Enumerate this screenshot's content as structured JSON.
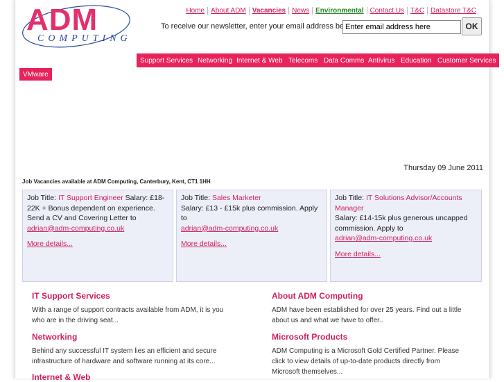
{
  "logo": {
    "top": "ADM",
    "bottom": "COMPUTING"
  },
  "toplinks": [
    "Home",
    "About ADM",
    "Vacancies",
    "News",
    "Environmental",
    "Contact Us",
    "T&C",
    "Datastore T&C"
  ],
  "newsletter": {
    "text": "To receive our newsletter, enter your email address below:",
    "placeholder": "Enter email address here",
    "ok": "OK"
  },
  "nav": [
    "Support Services",
    "Networking",
    "Internet & Web",
    "Telecoms",
    "Data Comms",
    "Antivirus",
    "Education",
    "Customer Services",
    "VMware"
  ],
  "date": "Thursday 09 June 2011",
  "vacancies": {
    "heading": "Job Vacancies available at ADM Computing, Canterbury, Kent, CT1 1HH",
    "jobs": [
      {
        "prefix": "Job Title:",
        "title": "IT Support Engineer",
        "desc": "Salary: £18-22K + Bonus dependent on experience. Send a CV and Covering Letter to",
        "email": "adrian@adm-computing.co.uk",
        "more": "More details..."
      },
      {
        "prefix": "Job Title:",
        "title": "Sales Marketer",
        "desc": "Salary: £13 - £15k plus commission. Apply to",
        "email": "adrian@adm-computing.co.uk",
        "more": "More details..."
      },
      {
        "prefix": "Job Title:",
        "title": "IT Solutions Advisor/Accounts Manager",
        "desc": "Salary: £14-15k plus generous uncapped commission. Apply to",
        "email": "adrian@adm-computing.co.uk",
        "more": "More details..."
      }
    ]
  },
  "sections": {
    "support": {
      "title": "IT Support Services",
      "text": "With a range of support contracts available from ADM, it is you who are in the driving seat..."
    },
    "networking": {
      "title": "Networking",
      "text": "Behind any successful IT system lies an efficient and secure infrastructure of hardware and software running at its core..."
    },
    "internet": {
      "title": "Internet & Web"
    },
    "about": {
      "title": "About ADM Computing",
      "text": "ADM have been established for over 25 years. Find out a little about us and what we have to offer.."
    },
    "microsoft": {
      "title": "Microsoft Products",
      "text": "ADM Computing is a Microsoft Gold Certified Partner. Please click to view details of up-to-date products directly from Microsoft themselves..."
    }
  },
  "colors": {
    "accent": "#e8225a",
    "link": "#d1225c",
    "environmental": "#2a8a2a",
    "box": "#eceef8"
  }
}
